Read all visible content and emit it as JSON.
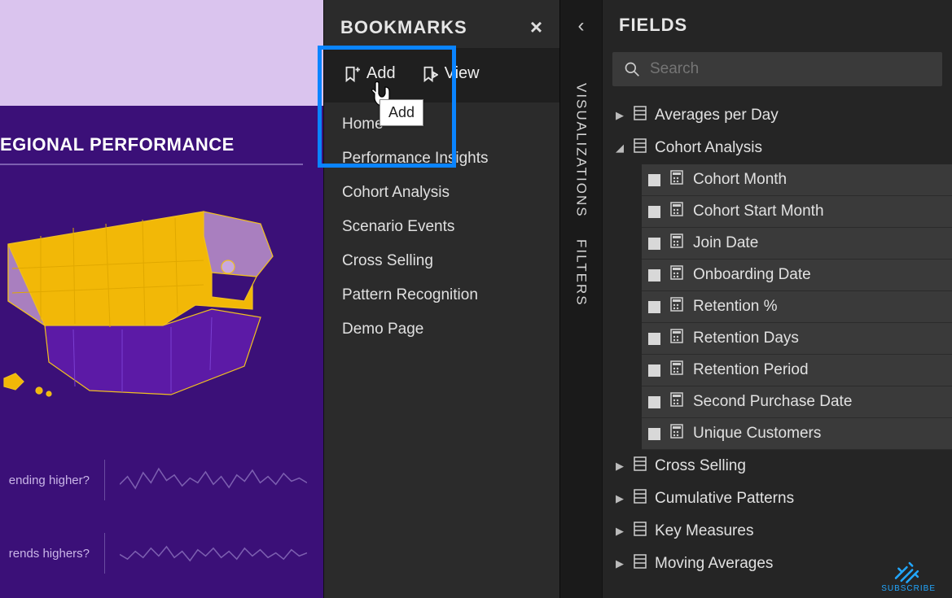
{
  "report": {
    "section_title": "EGIONAL PERFORMANCE",
    "sparkline_labels": [
      "ending higher?",
      "rends highers?"
    ]
  },
  "bookmarks_pane": {
    "title": "BOOKMARKS",
    "add_label": "Add",
    "view_label": "View",
    "tooltip": "Add",
    "items": [
      "Home",
      "Performance Insights",
      "Cohort Analysis",
      "Scenario Events",
      "Cross Selling",
      "Pattern Recognition",
      "Demo Page"
    ]
  },
  "side_tabs": {
    "visualizations": "VISUALIZATIONS",
    "filters": "FILTERS"
  },
  "fields_pane": {
    "title": "FIELDS",
    "search_placeholder": "Search",
    "tables": [
      {
        "name": "Averages per Day",
        "expanded": false,
        "fields": []
      },
      {
        "name": "Cohort Analysis",
        "expanded": true,
        "fields": [
          "Cohort Month",
          "Cohort Start Month",
          "Join Date",
          "Onboarding Date",
          "Retention %",
          "Retention Days",
          "Retention Period",
          "Second Purchase Date",
          "Unique Customers"
        ]
      },
      {
        "name": "Cross Selling",
        "expanded": false,
        "fields": []
      },
      {
        "name": "Cumulative Patterns",
        "expanded": false,
        "fields": []
      },
      {
        "name": "Key Measures",
        "expanded": false,
        "fields": []
      },
      {
        "name": "Moving Averages",
        "expanded": false,
        "fields": []
      }
    ]
  },
  "subscribe_badge": "SUBSCRIBE"
}
